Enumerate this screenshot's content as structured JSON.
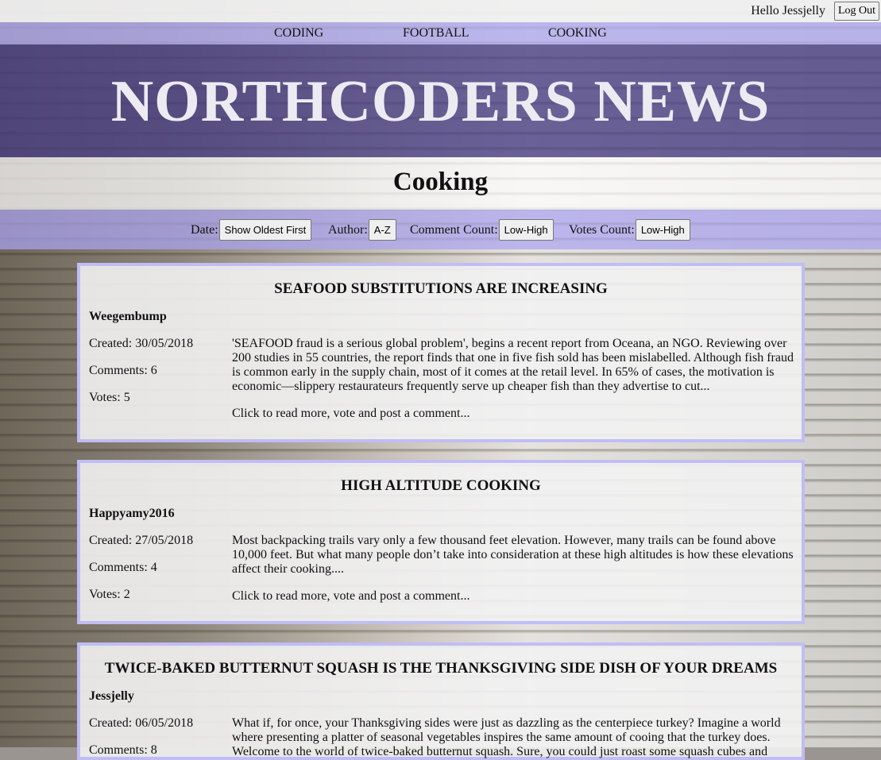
{
  "header": {
    "greeting": "Hello Jessjelly",
    "logout_label": "Log Out"
  },
  "nav": {
    "items": [
      "CODING",
      "FOOTBALL",
      "COOKING"
    ]
  },
  "site_title": "NORTHCODERS NEWS",
  "section_title": "Cooking",
  "sort": {
    "date": {
      "label": "Date:",
      "button": "Show Oldest First"
    },
    "author": {
      "label": "Author:",
      "button": "A-Z"
    },
    "comments": {
      "label": "Comment Count:",
      "button": "Low-High"
    },
    "votes": {
      "label": "Votes Count:",
      "button": "Low-High"
    }
  },
  "articles": [
    {
      "title": "SEAFOOD SUBSTITUTIONS ARE INCREASING",
      "author": "Weegembump",
      "created": "Created: 30/05/2018",
      "comments": "Comments: 6",
      "votes": "Votes: 5",
      "body": "'SEAFOOD fraud is a serious global problem', begins a recent report from Oceana, an NGO. Reviewing over 200 studies in 55 countries, the report finds that one in five fish sold has been mislabelled. Although fish fraud is common early in the supply chain, most of it comes at the retail level. In 65% of cases, the motivation is economic—slippery restaurateurs frequently serve up cheaper fish than they advertise to cut...",
      "more": "Click to read more, vote and post a comment..."
    },
    {
      "title": "HIGH ALTITUDE COOKING",
      "author": "Happyamy2016",
      "created": "Created: 27/05/2018",
      "comments": "Comments: 4",
      "votes": "Votes: 2",
      "body": "Most backpacking trails vary only a few thousand feet elevation. However, many trails can be found above 10,000 feet. But what many people don’t take into consideration at these high altitudes is how these elevations affect their cooking....",
      "more": "Click to read more, vote and post a comment..."
    },
    {
      "title": "TWICE-BAKED BUTTERNUT SQUASH IS THE THANKSGIVING SIDE DISH OF YOUR DREAMS",
      "author": "Jessjelly",
      "created": "Created: 06/05/2018",
      "comments": "Comments: 8",
      "body": "What if, for once, your Thanksgiving sides were just as dazzling as the centerpiece turkey? Imagine a world where presenting a platter of seasonal vegetables inspires the same amount of cooing that the turkey does. Welcome to the world of twice-baked butternut squash. Sure, you could just roast some squash cubes and"
    }
  ]
}
